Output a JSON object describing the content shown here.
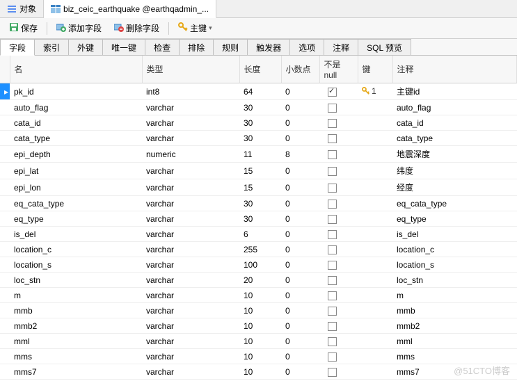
{
  "topTabs": {
    "inactive": "对象",
    "active": "biz_ceic_earthquake @earthqadmin_..."
  },
  "toolbar": {
    "save": "保存",
    "addField": "添加字段",
    "deleteField": "删除字段",
    "primaryKey": "主键"
  },
  "subTabs": [
    "字段",
    "索引",
    "外键",
    "唯一键",
    "检查",
    "排除",
    "规则",
    "触发器",
    "选项",
    "注释",
    "SQL 预览"
  ],
  "columns": {
    "name": "名",
    "type": "类型",
    "length": "长度",
    "decimal": "小数点",
    "notNull": "不是 null",
    "key": "键",
    "comment": "注释"
  },
  "rows": [
    {
      "name": "pk_id",
      "type": "int8",
      "len": "64",
      "dec": "0",
      "nn": true,
      "key": "1",
      "comment": "主键id",
      "sel": true
    },
    {
      "name": "auto_flag",
      "type": "varchar",
      "len": "30",
      "dec": "0",
      "nn": false,
      "key": "",
      "comment": "auto_flag"
    },
    {
      "name": "cata_id",
      "type": "varchar",
      "len": "30",
      "dec": "0",
      "nn": false,
      "key": "",
      "comment": "cata_id"
    },
    {
      "name": "cata_type",
      "type": "varchar",
      "len": "30",
      "dec": "0",
      "nn": false,
      "key": "",
      "comment": "cata_type"
    },
    {
      "name": "epi_depth",
      "type": "numeric",
      "len": "11",
      "dec": "8",
      "nn": false,
      "key": "",
      "comment": "地震深度"
    },
    {
      "name": "epi_lat",
      "type": "varchar",
      "len": "15",
      "dec": "0",
      "nn": false,
      "key": "",
      "comment": "纬度"
    },
    {
      "name": "epi_lon",
      "type": "varchar",
      "len": "15",
      "dec": "0",
      "nn": false,
      "key": "",
      "comment": "经度"
    },
    {
      "name": "eq_cata_type",
      "type": "varchar",
      "len": "30",
      "dec": "0",
      "nn": false,
      "key": "",
      "comment": "eq_cata_type"
    },
    {
      "name": "eq_type",
      "type": "varchar",
      "len": "30",
      "dec": "0",
      "nn": false,
      "key": "",
      "comment": "eq_type"
    },
    {
      "name": "is_del",
      "type": "varchar",
      "len": "6",
      "dec": "0",
      "nn": false,
      "key": "",
      "comment": "is_del"
    },
    {
      "name": "location_c",
      "type": "varchar",
      "len": "255",
      "dec": "0",
      "nn": false,
      "key": "",
      "comment": "location_c"
    },
    {
      "name": "location_s",
      "type": "varchar",
      "len": "100",
      "dec": "0",
      "nn": false,
      "key": "",
      "comment": "location_s"
    },
    {
      "name": "loc_stn",
      "type": "varchar",
      "len": "20",
      "dec": "0",
      "nn": false,
      "key": "",
      "comment": "loc_stn"
    },
    {
      "name": "m",
      "type": "varchar",
      "len": "10",
      "dec": "0",
      "nn": false,
      "key": "",
      "comment": "m"
    },
    {
      "name": "mmb",
      "type": "varchar",
      "len": "10",
      "dec": "0",
      "nn": false,
      "key": "",
      "comment": "mmb"
    },
    {
      "name": "mmb2",
      "type": "varchar",
      "len": "10",
      "dec": "0",
      "nn": false,
      "key": "",
      "comment": "mmb2"
    },
    {
      "name": "mml",
      "type": "varchar",
      "len": "10",
      "dec": "0",
      "nn": false,
      "key": "",
      "comment": "mml"
    },
    {
      "name": "mms",
      "type": "varchar",
      "len": "10",
      "dec": "0",
      "nn": false,
      "key": "",
      "comment": "mms"
    },
    {
      "name": "mms7",
      "type": "varchar",
      "len": "10",
      "dec": "0",
      "nn": false,
      "key": "",
      "comment": "mms7"
    }
  ],
  "watermark": "@51CTO博客"
}
